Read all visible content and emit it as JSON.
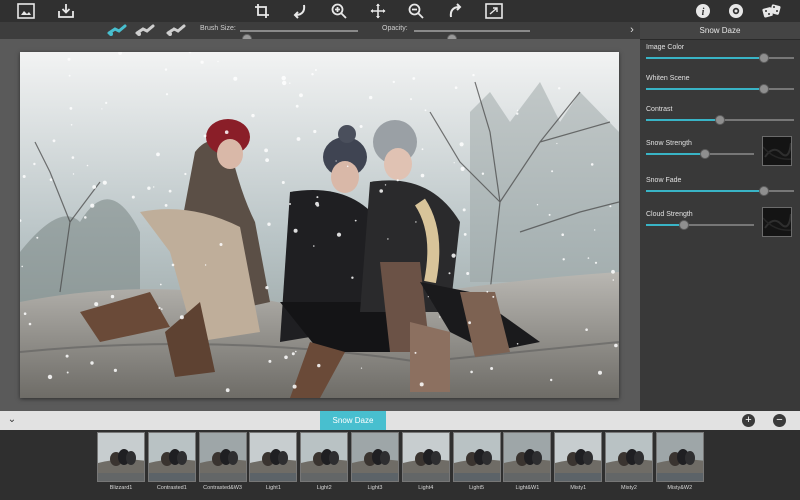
{
  "toolbar": {
    "icons": [
      "photo-browser-icon",
      "save-icon",
      "crop-icon",
      "undo-icon",
      "zoom-in-icon",
      "move-icon",
      "zoom-out-icon",
      "redo-icon",
      "fit-to-screen-icon",
      "info-icon",
      "settings-icon",
      "randomize-dice-icon"
    ]
  },
  "options_bar": {
    "brushes": [
      "paint-brush-icon",
      "erase-brush-icon",
      "soft-brush-icon"
    ],
    "brush_size_label": "Brush Size:",
    "brush_size_value": 0.06,
    "opacity_label": "Opacity:",
    "opacity_value": 0.33
  },
  "panel": {
    "title": "Snow Daze",
    "controls": [
      {
        "label": "Image Color",
        "value": 0.8,
        "texture": false
      },
      {
        "label": "Whiten Scene",
        "value": 0.8,
        "texture": false
      },
      {
        "label": "Contrast",
        "value": 0.5,
        "texture": false
      },
      {
        "label": "Snow Strength",
        "value": 0.55,
        "texture": true
      },
      {
        "label": "Snow Fade",
        "value": 0.8,
        "texture": false
      },
      {
        "label": "Cloud Strength",
        "value": 0.35,
        "texture": true
      }
    ]
  },
  "presets_bar": {
    "collapse_icon": "chevron-down-icon",
    "active_tab": "Snow Daze",
    "add_icon": "plus-icon",
    "remove_icon": "minus-icon"
  },
  "thumbnails": [
    "Blizzard1",
    "Contrasted1",
    "Contrasted&W3",
    "Light1",
    "Light2",
    "Light3",
    "Light4",
    "Light5",
    "Light&W1",
    "Misty1",
    "Misty2",
    "Misty&W2"
  ],
  "colors": {
    "accent": "#48bfcf",
    "slider_fill": "#39b4c6",
    "canvas_bg": "#5a5a5a",
    "panel_bg": "#393939"
  }
}
